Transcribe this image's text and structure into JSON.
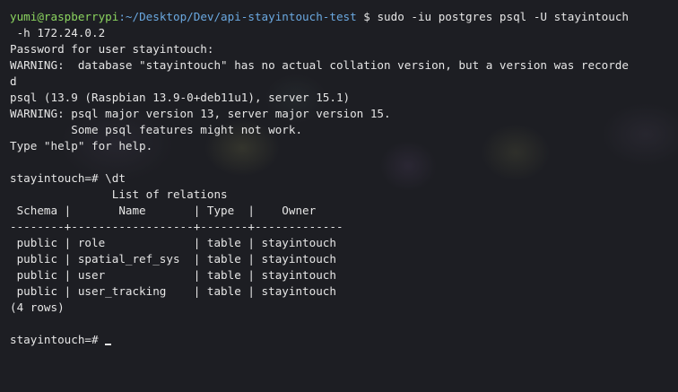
{
  "terminal": {
    "prompt": {
      "user_host": "yumi@raspberrypi",
      "path": ":~/Desktop/Dev/api-stayintouch-test",
      "symbol": " $ ",
      "command": "sudo -iu postgres psql -U stayintouch"
    },
    "lines": [
      " -h 172.24.0.2",
      "Password for user stayintouch:",
      "WARNING:  database \"stayintouch\" has no actual collation version, but a version was recorde",
      "d",
      "psql (13.9 (Raspbian 13.9-0+deb11u1), server 15.1)",
      "WARNING: psql major version 13, server major version 15.",
      "         Some psql features might not work.",
      "Type \"help\" for help.",
      "",
      "stayintouch=# \\dt",
      "               List of relations",
      " Schema |       Name       | Type  |    Owner",
      "--------+------------------+-------+-------------",
      " public | role             | table | stayintouch",
      " public | spatial_ref_sys  | table | stayintouch",
      " public | user             | table | stayintouch",
      " public | user_tracking    | table | stayintouch",
      "(4 rows)",
      ""
    ],
    "final_prompt": "stayintouch=# ",
    "colors": {
      "background": "#1d1e23",
      "text": "#e6e6e6",
      "prompt_user": "#8bd45f",
      "prompt_path": "#6aa8e0"
    }
  }
}
